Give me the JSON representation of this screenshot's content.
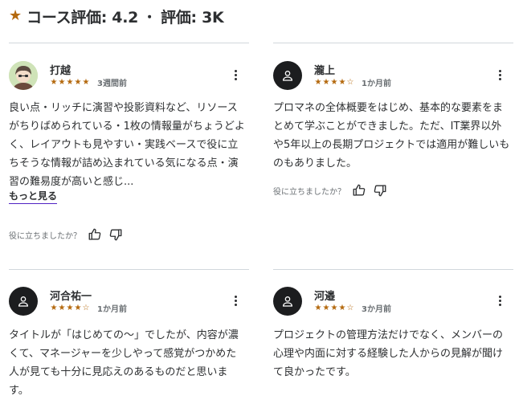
{
  "header": {
    "star_icon": "star-icon",
    "course_rating": "コース評価: 4.2",
    "separator": "・",
    "rating_count": "評価: 3K"
  },
  "helpful_label": "役に立ちましたか？",
  "reviews": [
    {
      "name": "打越",
      "rating": 5,
      "time": "3週間前",
      "text": "良い点・リッチに演習や投影資料など、リソースがちりばめられている・1枚の情報量がちょうどよく、レイアウトも見やすい・実践ベースで役に立ちそうな情報が詰め込まれている気になる点・演習の難易度が高いと感じ...",
      "more": "もっと見る",
      "avatar": "photo"
    },
    {
      "name": "瀧上",
      "rating": 4,
      "time": "1か月前",
      "text": "プロマネの全体概要をはじめ、基本的な要素をまとめて学ぶことができました。ただ、IT業界以外や5年以上の長期プロジェクトでは適用が難しいものもありました。",
      "avatar": "person-icon"
    },
    {
      "name": "河合祐一",
      "rating": 4,
      "time": "1か月前",
      "text": "タイトルが「はじめての〜」でしたが、内容が濃くて、マネージャーを少しやって感覚がつかめた人が見ても十分に見応えのあるものだと思います。",
      "avatar": "person-icon"
    },
    {
      "name": "河邉",
      "rating": 4,
      "time": "3か月前",
      "text": "プロジェクトの管理方法だけでなく、メンバーの心理や内面に対する経験した人からの見解が聞けて良かったです。",
      "avatar": "person-icon"
    }
  ],
  "colors": {
    "star": "#b4690e",
    "text": "#2d2f31",
    "muted": "#6a6f73",
    "divider": "#d1d7dc",
    "link_underline": "#5022c3"
  }
}
